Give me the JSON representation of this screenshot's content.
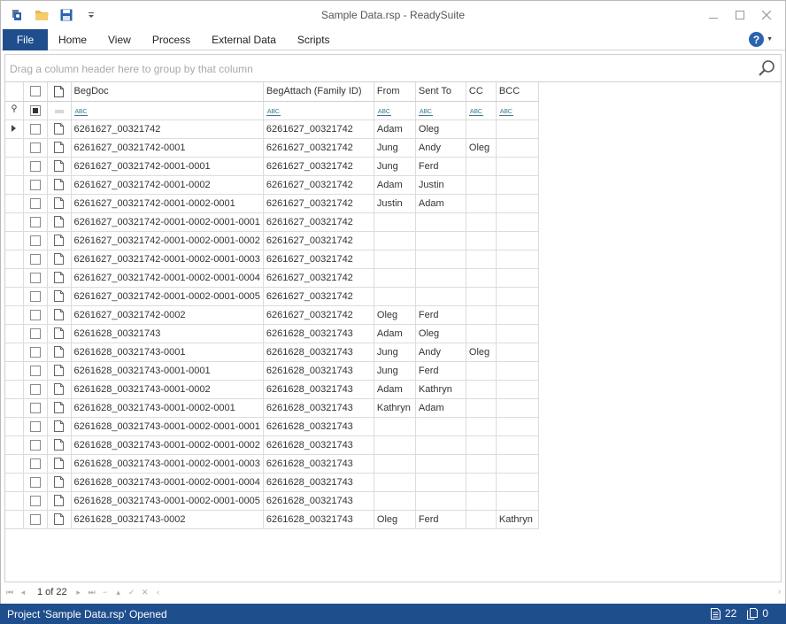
{
  "window": {
    "title": "Sample Data.rsp - ReadySuite",
    "controls": [
      "minimize",
      "maximize",
      "close"
    ]
  },
  "quick_access": {
    "icons": [
      "app-icon",
      "open-folder-icon",
      "save-icon",
      "customize-dropdown-icon"
    ]
  },
  "ribbon": {
    "file_label": "File",
    "tabs": [
      "Home",
      "View",
      "Process",
      "External Data",
      "Scripts"
    ],
    "help_label": "?"
  },
  "group_panel": {
    "hint": "Drag a column header here to group by that column"
  },
  "grid": {
    "columns": [
      "BegDoc",
      "BegAttach (Family ID)",
      "From",
      "Sent To",
      "CC",
      "BCC"
    ],
    "filter_icon_label": "ABC",
    "rows": [
      [
        "6261627_00321742",
        "6261627_00321742",
        "Adam",
        "Oleg",
        "",
        ""
      ],
      [
        "6261627_00321742-0001",
        "6261627_00321742",
        "Jung",
        "Andy",
        "Oleg",
        ""
      ],
      [
        "6261627_00321742-0001-0001",
        "6261627_00321742",
        "Jung",
        "Ferd",
        "",
        ""
      ],
      [
        "6261627_00321742-0001-0002",
        "6261627_00321742",
        "Adam",
        "Justin",
        "",
        ""
      ],
      [
        "6261627_00321742-0001-0002-0001",
        "6261627_00321742",
        "Justin",
        "Adam",
        "",
        ""
      ],
      [
        "6261627_00321742-0001-0002-0001-0001",
        "6261627_00321742",
        "",
        "",
        "",
        ""
      ],
      [
        "6261627_00321742-0001-0002-0001-0002",
        "6261627_00321742",
        "",
        "",
        "",
        ""
      ],
      [
        "6261627_00321742-0001-0002-0001-0003",
        "6261627_00321742",
        "",
        "",
        "",
        ""
      ],
      [
        "6261627_00321742-0001-0002-0001-0004",
        "6261627_00321742",
        "",
        "",
        "",
        ""
      ],
      [
        "6261627_00321742-0001-0002-0001-0005",
        "6261627_00321742",
        "",
        "",
        "",
        ""
      ],
      [
        "6261627_00321742-0002",
        "6261627_00321742",
        "Oleg",
        "Ferd",
        "",
        ""
      ],
      [
        "6261628_00321743",
        "6261628_00321743",
        "Adam",
        "Oleg",
        "",
        ""
      ],
      [
        "6261628_00321743-0001",
        "6261628_00321743",
        "Jung",
        "Andy",
        "Oleg",
        ""
      ],
      [
        "6261628_00321743-0001-0001",
        "6261628_00321743",
        "Jung",
        "Ferd",
        "",
        ""
      ],
      [
        "6261628_00321743-0001-0002",
        "6261628_00321743",
        "Adam",
        "Kathryn",
        "",
        ""
      ],
      [
        "6261628_00321743-0001-0002-0001",
        "6261628_00321743",
        "Kathryn",
        "Adam",
        "",
        ""
      ],
      [
        "6261628_00321743-0001-0002-0001-0001",
        "6261628_00321743",
        "",
        "",
        "",
        ""
      ],
      [
        "6261628_00321743-0001-0002-0001-0002",
        "6261628_00321743",
        "",
        "",
        "",
        ""
      ],
      [
        "6261628_00321743-0001-0002-0001-0003",
        "6261628_00321743",
        "",
        "",
        "",
        ""
      ],
      [
        "6261628_00321743-0001-0002-0001-0004",
        "6261628_00321743",
        "",
        "",
        "",
        ""
      ],
      [
        "6261628_00321743-0001-0002-0001-0005",
        "6261628_00321743",
        "",
        "",
        "",
        ""
      ],
      [
        "6261628_00321743-0002",
        "6261628_00321743",
        "Oleg",
        "Ferd",
        "",
        "Kathryn"
      ]
    ]
  },
  "pager": {
    "info": "1 of 22"
  },
  "status": {
    "message": "Project 'Sample Data.rsp' Opened",
    "doc_count": "22",
    "page_count": "0"
  },
  "colors": {
    "accent": "#1f4e8c",
    "help": "#2a64b0",
    "grid_line": "#dcdcdc"
  }
}
